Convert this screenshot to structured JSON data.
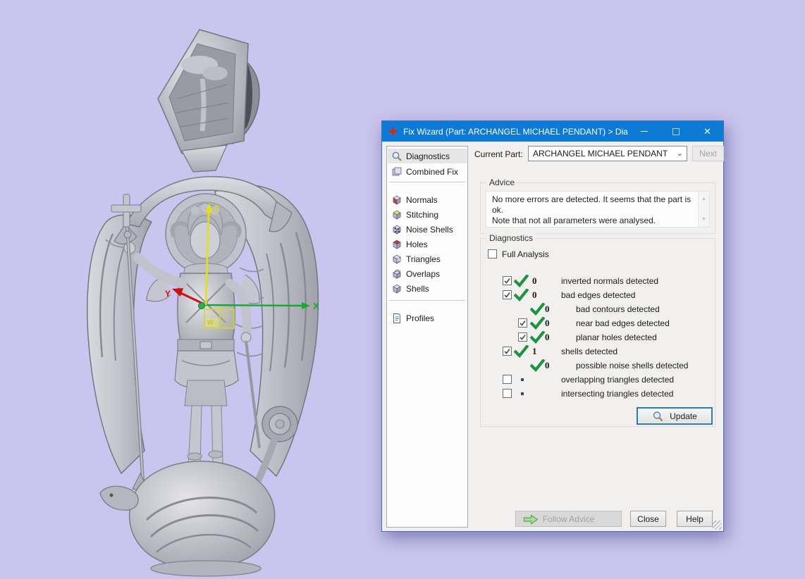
{
  "colors": {
    "viewport_background": "#c9c5ee",
    "titlebar_blue": "#0d7ad5",
    "check_green": "#1f9440",
    "axis_x_green": "#17a82f",
    "axis_y_red": "#cc1111",
    "axis_z_yellow": "#d8d818",
    "update_focus_border": "#2e7aa8",
    "app_icon_red": "#d42a1e"
  },
  "viewport": {
    "model_name": "archangel-michael-pendant",
    "axis_x_label": "X",
    "axis_y_label": "Y",
    "axis_z_label": "Z",
    "gizmo_label": "W"
  },
  "dialog": {
    "title": "Fix Wizard (Part: ARCHANGEL MICHAEL PENDANT) > Diag...",
    "sidebar": {
      "items": [
        {
          "label": "Diagnostics",
          "selected": true
        },
        {
          "label": "Combined Fix",
          "selected": false
        },
        {
          "label": "Normals",
          "selected": false
        },
        {
          "label": "Stitching",
          "selected": false
        },
        {
          "label": "Noise Shells",
          "selected": false
        },
        {
          "label": "Holes",
          "selected": false
        },
        {
          "label": "Triangles",
          "selected": false
        },
        {
          "label": "Overlaps",
          "selected": false
        },
        {
          "label": "Shells",
          "selected": false
        },
        {
          "label": "Profiles",
          "selected": false
        }
      ]
    },
    "current_part": {
      "label": "Current Part:",
      "value": "ARCHANGEL MICHAEL PENDANT",
      "next_button": "Next"
    },
    "advice": {
      "group_label": "Advice",
      "line1": "No more errors are detected. It seems that the part is ok.",
      "line2": "Note that not all parameters were analysed."
    },
    "diagnostics": {
      "group_label": "Diagnostics",
      "full_analysis_label": "Full Analysis",
      "rows": [
        {
          "has_checkbox": true,
          "checked": true,
          "status": "ok",
          "indent": 0,
          "count": "0",
          "label": "inverted normals detected"
        },
        {
          "has_checkbox": true,
          "checked": true,
          "status": "ok",
          "indent": 0,
          "count": "0",
          "label": "bad edges detected"
        },
        {
          "has_checkbox": false,
          "checked": false,
          "status": "ok",
          "indent": 1,
          "count": "0",
          "label": "bad contours detected"
        },
        {
          "has_checkbox": true,
          "checked": true,
          "status": "ok",
          "indent": 1,
          "count": "0",
          "label": "near bad edges detected"
        },
        {
          "has_checkbox": true,
          "checked": true,
          "status": "ok",
          "indent": 1,
          "count": "0",
          "label": "planar holes detected"
        },
        {
          "has_checkbox": true,
          "checked": true,
          "status": "ok",
          "indent": 0,
          "count": "1",
          "label": "shells detected"
        },
        {
          "has_checkbox": false,
          "checked": false,
          "status": "ok",
          "indent": 1,
          "count": "0",
          "label": "possible noise shells detected"
        },
        {
          "has_checkbox": true,
          "checked": false,
          "status": "none",
          "indent": 0,
          "count": "",
          "label": "overlapping triangles detected"
        },
        {
          "has_checkbox": true,
          "checked": false,
          "status": "none",
          "indent": 0,
          "count": "",
          "label": "intersecting triangles detected"
        }
      ],
      "update_button": "Update"
    },
    "footer": {
      "follow_advice_button": "Follow Advice",
      "close_button": "Close",
      "help_button": "Help"
    }
  }
}
